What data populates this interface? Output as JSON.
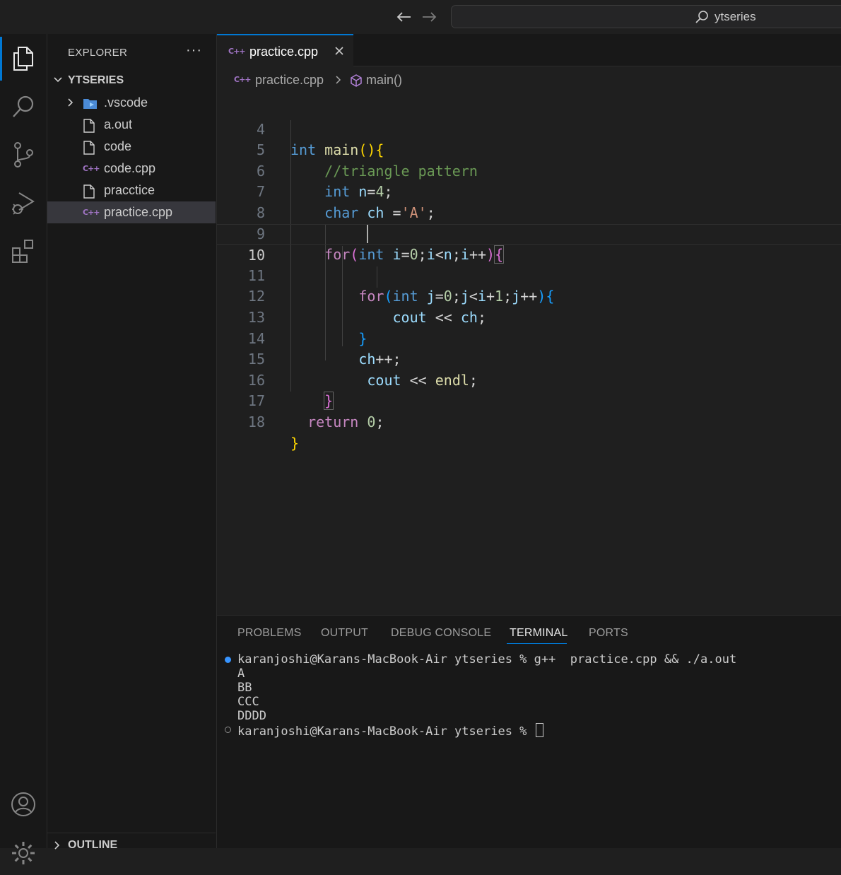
{
  "titlebar": {
    "back_icon": "arrow-left-icon",
    "forward_icon": "arrow-right-icon",
    "search_text": "ytseries"
  },
  "activity_bar": {
    "items": [
      "explorer-icon",
      "search-icon",
      "source-control-icon",
      "run-debug-icon",
      "extensions-icon"
    ],
    "bottom": [
      "account-icon",
      "settings-gear-icon"
    ]
  },
  "explorer": {
    "title": "EXPLORER",
    "more": "···",
    "folder": "YTSERIES",
    "files": [
      {
        "name": ".vscode",
        "type": "folder"
      },
      {
        "name": "a.out",
        "type": "file"
      },
      {
        "name": "code",
        "type": "file"
      },
      {
        "name": "code.cpp",
        "type": "cpp"
      },
      {
        "name": "pracctice",
        "type": "file"
      },
      {
        "name": "practice.cpp",
        "type": "cpp",
        "selected": true
      }
    ],
    "outline": "OUTLINE"
  },
  "editor": {
    "tab_label": "practice.cpp",
    "breadcrumb_file": "practice.cpp",
    "breadcrumb_symbol": "main()",
    "current_line": 10,
    "line_numbers": [
      "4",
      "5",
      "6",
      "7",
      "8",
      "9",
      "10",
      "11",
      "12",
      "13",
      "14",
      "15",
      "16",
      "17",
      "18"
    ],
    "code_lines": [
      "int main(){",
      "    //triangle pattern",
      "    int n=4;",
      "    char ch ='A';",
      "",
      "    for(int i=0;i<n;i++){",
      "",
      "        for(int j=0;j<i+1;j++){",
      "            cout << ch;",
      "        }",
      "        ch++;",
      "         cout << endl;",
      "    }",
      "  return 0;",
      "}"
    ]
  },
  "panel": {
    "tabs": [
      "PROBLEMS",
      "OUTPUT",
      "DEBUG CONSOLE",
      "TERMINAL",
      "PORTS"
    ],
    "active_tab": "TERMINAL",
    "terminal": {
      "command_line": "karanjoshi@Karans-MacBook-Air ytseries % g++  practice.cpp && ./a.out",
      "output": [
        "A",
        "BB",
        "CCC",
        "DDDD"
      ],
      "prompt": "karanjoshi@Karans-MacBook-Air ytseries % ",
      "success_color": "#3794ff"
    }
  }
}
